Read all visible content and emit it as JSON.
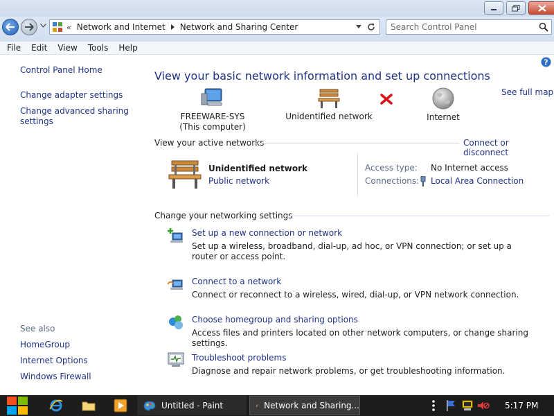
{
  "address_bar": {
    "crumbs": [
      "Network and Internet",
      "Network and Sharing Center"
    ],
    "search_placeholder": "Search Control Panel"
  },
  "menu": [
    "File",
    "Edit",
    "View",
    "Tools",
    "Help"
  ],
  "left_pane": {
    "home": "Control Panel Home",
    "links": [
      "Change adapter settings",
      "Change advanced sharing settings"
    ],
    "see_also_label": "See also",
    "see_also": [
      "HomeGroup",
      "Internet Options",
      "Windows Firewall"
    ]
  },
  "main": {
    "title": "View your basic network information and set up connections",
    "see_full_map": "See full map",
    "map": {
      "computer_name": "FREEWARE-SYS",
      "computer_sub": "(This computer)",
      "network": "Unidentified network",
      "internet": "Internet"
    },
    "active_networks": {
      "header": "View your active networks",
      "connect_link": "Connect or disconnect",
      "network_name": "Unidentified network",
      "network_category": "Public network",
      "access_type_label": "Access type:",
      "access_type_value": "No Internet access",
      "connections_label": "Connections:",
      "connections_value": "Local Area Connection"
    },
    "settings": {
      "header": "Change your networking settings",
      "tasks": [
        {
          "title": "Set up a new connection or network",
          "desc": "Set up a wireless, broadband, dial-up, ad hoc, or VPN connection; or set up a router or access point."
        },
        {
          "title": "Connect to a network",
          "desc": "Connect or reconnect to a wireless, wired, dial-up, or VPN network connection."
        },
        {
          "title": "Choose homegroup and sharing options",
          "desc": "Access files and printers located on other network computers, or change sharing settings."
        },
        {
          "title": "Troubleshoot problems",
          "desc": "Diagnose and repair network problems, or get troubleshooting information."
        }
      ]
    }
  },
  "taskbar": {
    "items": [
      "Untitled - Paint",
      "Network and Sharing..."
    ],
    "clock": "5:17 PM"
  },
  "colors": {
    "link": "#1e3287",
    "taskbar": "#1c1c1c",
    "close_button": "#c74b32"
  }
}
